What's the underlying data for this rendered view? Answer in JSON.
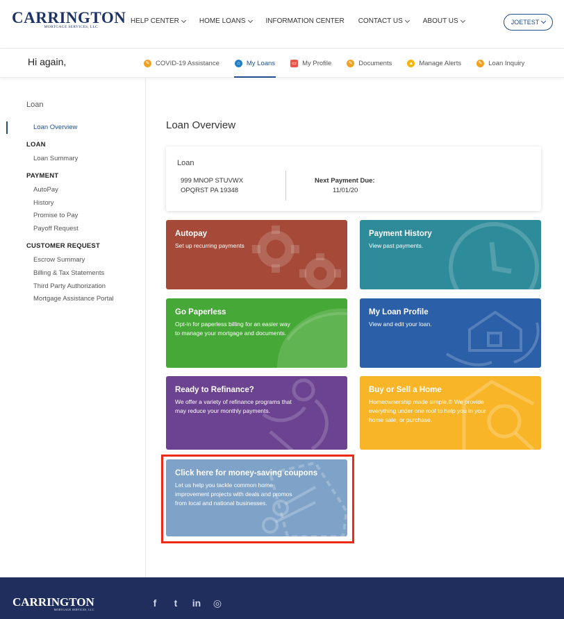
{
  "header": {
    "logo_text": "CARRINGTON",
    "logo_sub": "MORTGAGE SERVICES, LLC",
    "nav": [
      {
        "label": "HELP CENTER",
        "dropdown": true
      },
      {
        "label": "HOME LOANS",
        "dropdown": true
      },
      {
        "label": "INFORMATION CENTER",
        "dropdown": false
      },
      {
        "label": "CONTACT US",
        "dropdown": true
      },
      {
        "label": "ABOUT US",
        "dropdown": true
      }
    ],
    "user_label": "JOETEST"
  },
  "subheader": {
    "greeting": "Hi again,",
    "tabs": [
      {
        "label": "COVID-19 Assistance",
        "icon": "info-icon",
        "color": "#f0a020"
      },
      {
        "label": "My Loans",
        "icon": "house-icon",
        "color": "#1e7fc8",
        "active": true
      },
      {
        "label": "My Profile",
        "icon": "profile-icon",
        "color": "#e05a4a"
      },
      {
        "label": "Documents",
        "icon": "document-icon",
        "color": "#f0a020"
      },
      {
        "label": "Manage Alerts",
        "icon": "bell-icon",
        "color": "#f5b400"
      },
      {
        "label": "Loan Inquiry",
        "icon": "inquiry-icon",
        "color": "#f0a020"
      }
    ]
  },
  "sidebar": {
    "title": "Loan",
    "active_item": "Loan Overview",
    "groups": [
      {
        "label": "LOAN",
        "items": [
          "Loan Summary"
        ]
      },
      {
        "label": "PAYMENT",
        "items": [
          "AutoPay",
          "History",
          "Promise to Pay",
          "Payoff Request"
        ]
      },
      {
        "label": "CUSTOMER REQUEST",
        "items": [
          "Escrow Summary",
          "Billing & Tax Statements",
          "Third Party Authorization",
          "Mortgage Assistance Portal"
        ]
      }
    ]
  },
  "main": {
    "title": "Loan Overview",
    "loan_card": {
      "label": "Loan",
      "address_line1": "999 MNOP STUVWX",
      "address_line2": "OPQRST PA 19348",
      "next_payment_label": "Next Payment Due:",
      "next_payment_date": "11/01/20"
    },
    "tiles": [
      {
        "title": "Autopay",
        "desc": "Set up recurring payments",
        "color": "#a54a38"
      },
      {
        "title": "Payment History",
        "desc": "View past payments.",
        "color": "#2e8c9a"
      },
      {
        "title": "Go Paperless",
        "desc": "Opt-in for paperless billing for an easier way to manage your mortgage and documents.",
        "color": "#46a836"
      },
      {
        "title": "My Loan Profile",
        "desc": "View and edit your loan.",
        "color": "#2b5fa8"
      },
      {
        "title": "Ready to Refinance?",
        "desc": "We offer a variety of refinance programs that may reduce your monthly payments.",
        "color": "#6b4390"
      },
      {
        "title": "Buy or Sell a Home",
        "desc": "Homeownership made simple.® We provide everything under one roof to help you in your home sale, or purchase.",
        "color": "#f8b528"
      },
      {
        "title": "Click here for money-saving coupons",
        "desc": "Let us help you tackle common home improvement projects with deals and promos from local and national businesses.",
        "color": "#7fa3c8"
      }
    ]
  },
  "footer": {
    "logo_text": "CARRINGTON",
    "logo_sub": "MORTGAGE SERVICES, LLC",
    "social": [
      {
        "icon": "facebook-icon",
        "glyph": "f"
      },
      {
        "icon": "twitter-icon",
        "glyph": "t"
      },
      {
        "icon": "linkedin-icon",
        "glyph": "in"
      },
      {
        "icon": "instagram-icon",
        "glyph": "◎"
      }
    ]
  }
}
